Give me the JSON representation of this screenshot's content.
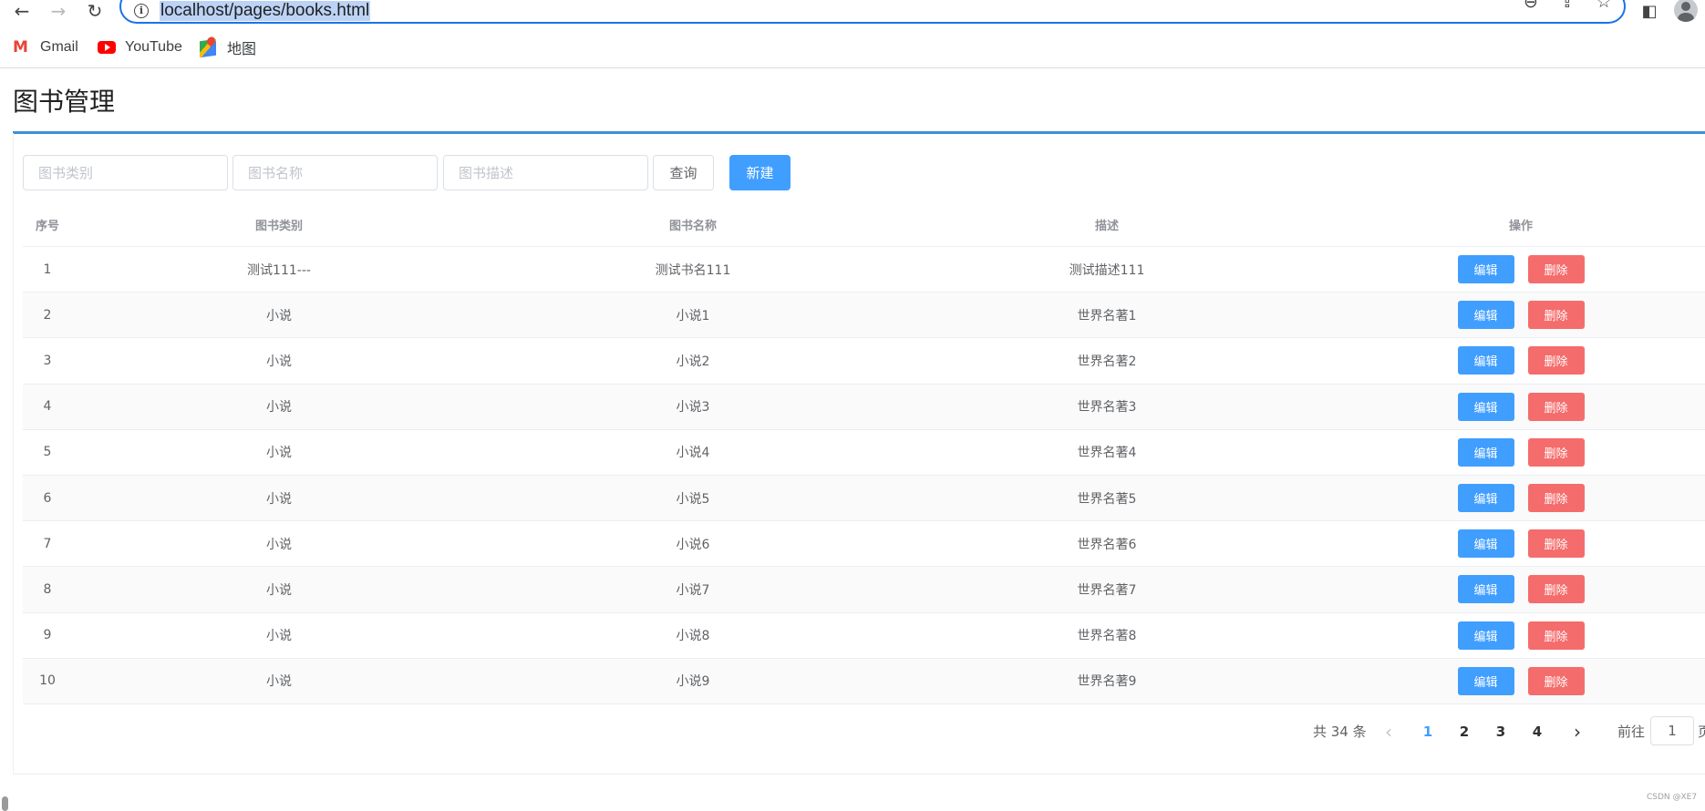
{
  "browser": {
    "url": "localhost/pages/books.html",
    "bookmarks": [
      {
        "label": "Gmail",
        "icon": "gmail-icon"
      },
      {
        "label": "YouTube",
        "icon": "youtube-icon"
      },
      {
        "label": "地图",
        "icon": "maps-icon"
      }
    ]
  },
  "page": {
    "title": "图书管理"
  },
  "filters": {
    "category_placeholder": "图书类别",
    "name_placeholder": "图书名称",
    "description_placeholder": "图书描述",
    "query_label": "查询",
    "new_label": "新建"
  },
  "table": {
    "headers": [
      "序号",
      "图书类别",
      "图书名称",
      "描述",
      "操作"
    ],
    "edit_label": "编辑",
    "delete_label": "删除",
    "rows": [
      {
        "index": "1",
        "category": "测试111---",
        "name": "测试书名111",
        "description": "测试描述111"
      },
      {
        "index": "2",
        "category": "小说",
        "name": "小说1",
        "description": "世界名著1"
      },
      {
        "index": "3",
        "category": "小说",
        "name": "小说2",
        "description": "世界名著2"
      },
      {
        "index": "4",
        "category": "小说",
        "name": "小说3",
        "description": "世界名著3"
      },
      {
        "index": "5",
        "category": "小说",
        "name": "小说4",
        "description": "世界名著4"
      },
      {
        "index": "6",
        "category": "小说",
        "name": "小说5",
        "description": "世界名著5"
      },
      {
        "index": "7",
        "category": "小说",
        "name": "小说6",
        "description": "世界名著6"
      },
      {
        "index": "8",
        "category": "小说",
        "name": "小说7",
        "description": "世界名著7"
      },
      {
        "index": "9",
        "category": "小说",
        "name": "小说8",
        "description": "世界名著8"
      },
      {
        "index": "10",
        "category": "小说",
        "name": "小说9",
        "description": "世界名著9"
      }
    ]
  },
  "pagination": {
    "total": "共 34 条",
    "pages": [
      "1",
      "2",
      "3",
      "4"
    ],
    "current_page": "1",
    "goto_label": "前往",
    "goto_value": "1",
    "goto_suffix": "页"
  },
  "watermark": "CSDN @XE7",
  "colors": {
    "primary": "#409eff",
    "danger": "#f56c6c",
    "title_rule": "#3f8fd8"
  }
}
